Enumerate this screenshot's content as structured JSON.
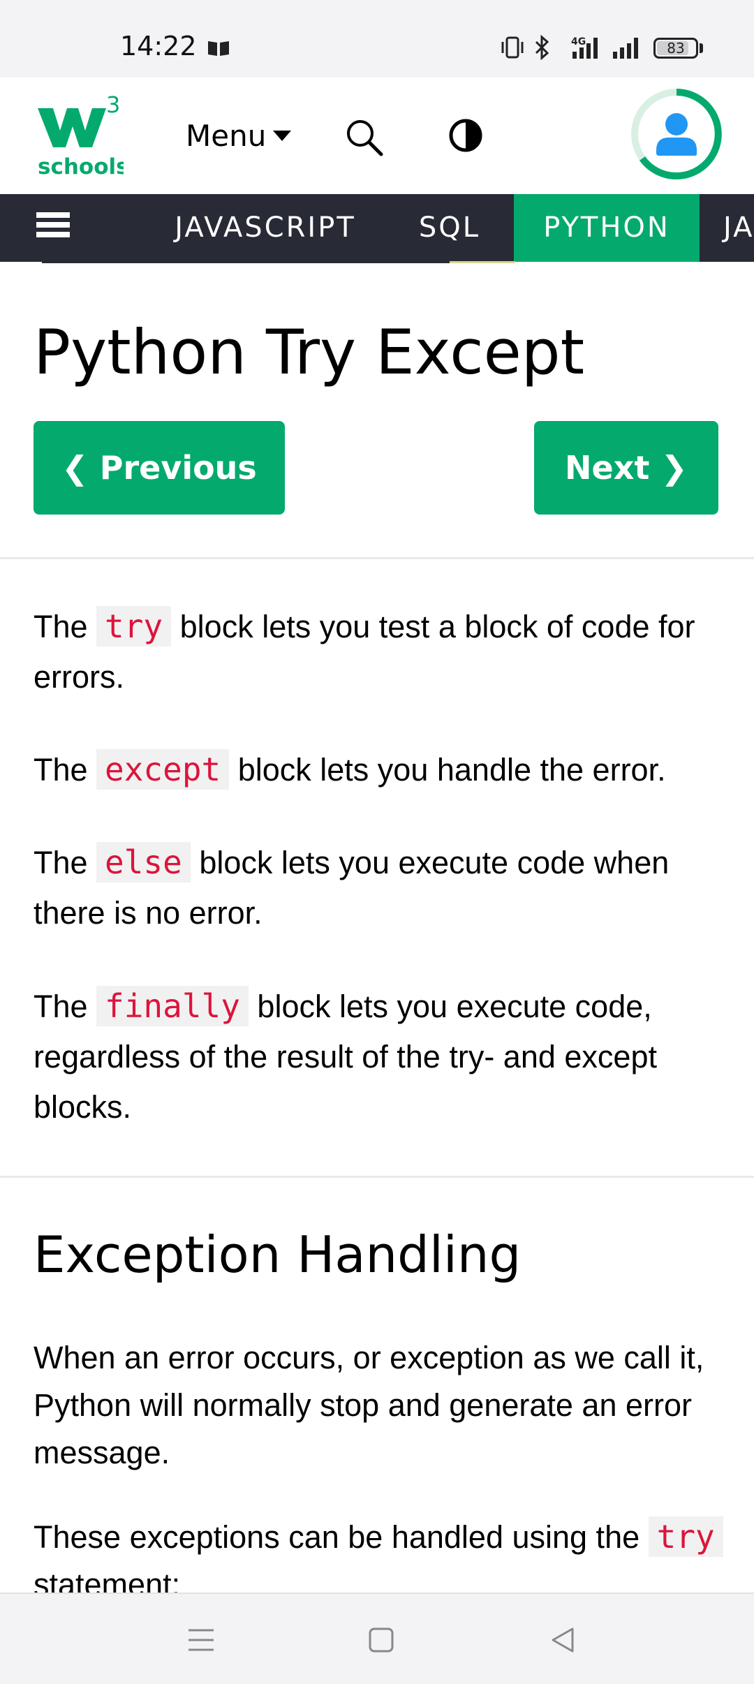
{
  "status_bar": {
    "time": "14:22",
    "network": "4G",
    "battery": "83",
    "battery_level": 0.83
  },
  "header": {
    "logo_superscript": "3",
    "logo_text": "schools",
    "menu_label": "Menu",
    "brand_color": "#04aa6d"
  },
  "navbar": {
    "items": [
      "JAVASCRIPT",
      "SQL",
      "PYTHON",
      "JA"
    ],
    "active": "PYTHON"
  },
  "page": {
    "title": "Python Try Except",
    "prev_label": "❮ Previous",
    "next_label": "Next ❯",
    "paragraphs": [
      {
        "before": "The ",
        "code": "try",
        "after": " block lets you test a block of code for errors."
      },
      {
        "before": "The ",
        "code": "except",
        "after": " block lets you handle the error."
      },
      {
        "before": "The ",
        "code": "else",
        "after": " block lets you execute code when there is no error."
      },
      {
        "before": "The ",
        "code": "finally",
        "after": " block lets you execute code, regardless of the result of the try- and except blocks."
      }
    ],
    "section_title": "Exception Handling",
    "section_paragraph_1": "When an error occurs, or exception as we call it, Python will normally stop and generate an error message.",
    "section_paragraph_2_before": "These exceptions can be handled using the ",
    "section_paragraph_2_code": "try",
    "section_paragraph_2_after": " statement:"
  },
  "icons": {
    "status": [
      "book-icon",
      "vibrate-icon",
      "bluetooth-icon",
      "signal-icon",
      "battery-icon"
    ],
    "header": [
      "search-icon",
      "contrast-icon",
      "avatar-icon"
    ],
    "system_nav": [
      "menu-lines-icon",
      "home-square-icon",
      "back-triangle-icon"
    ]
  }
}
